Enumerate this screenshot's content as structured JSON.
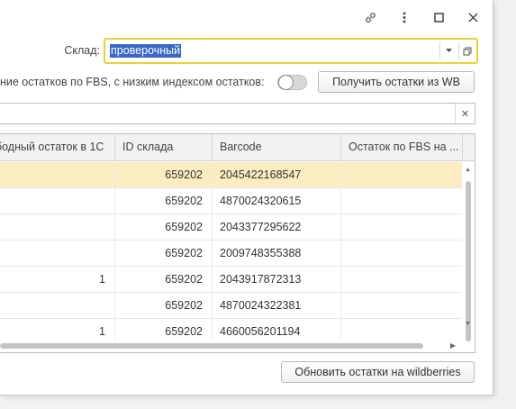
{
  "titlebar": {
    "icons": [
      "link-icon",
      "more-vertical-icon",
      "maximize-icon",
      "close-icon"
    ]
  },
  "sklad": {
    "label": "Склад:",
    "value": "проверочный"
  },
  "fbs": {
    "label": "ние остатков по FBS, с низким индексом остатков:",
    "toggle_on": false
  },
  "buttons": {
    "get_stock": "Получить остатки из WB",
    "update_stock": "Обновить остатки на wildberries"
  },
  "search": {
    "value": ""
  },
  "table": {
    "headers": [
      "ободный остаток в 1С",
      "ID склада",
      "Barcode",
      "Остаток по FBS на ..."
    ],
    "rows": [
      {
        "free": "",
        "warehouse_id": "659202",
        "barcode": "2045422168547",
        "fbs": ""
      },
      {
        "free": "",
        "warehouse_id": "659202",
        "barcode": "4870024320615",
        "fbs": ""
      },
      {
        "free": "",
        "warehouse_id": "659202",
        "barcode": "2043377295622",
        "fbs": ""
      },
      {
        "free": "",
        "warehouse_id": "659202",
        "barcode": "2009748355388",
        "fbs": ""
      },
      {
        "free": "1",
        "warehouse_id": "659202",
        "barcode": "2043917872313",
        "fbs": ""
      },
      {
        "free": "",
        "warehouse_id": "659202",
        "barcode": "4870024322381",
        "fbs": ""
      },
      {
        "free": "1",
        "warehouse_id": "659202",
        "barcode": "4660056201194",
        "fbs": ""
      }
    ],
    "selected_row": 0
  },
  "colors": {
    "focus_border": "#e8d33a",
    "selection_highlight": "#3a68c8",
    "selected_row": "#fbecc1"
  }
}
